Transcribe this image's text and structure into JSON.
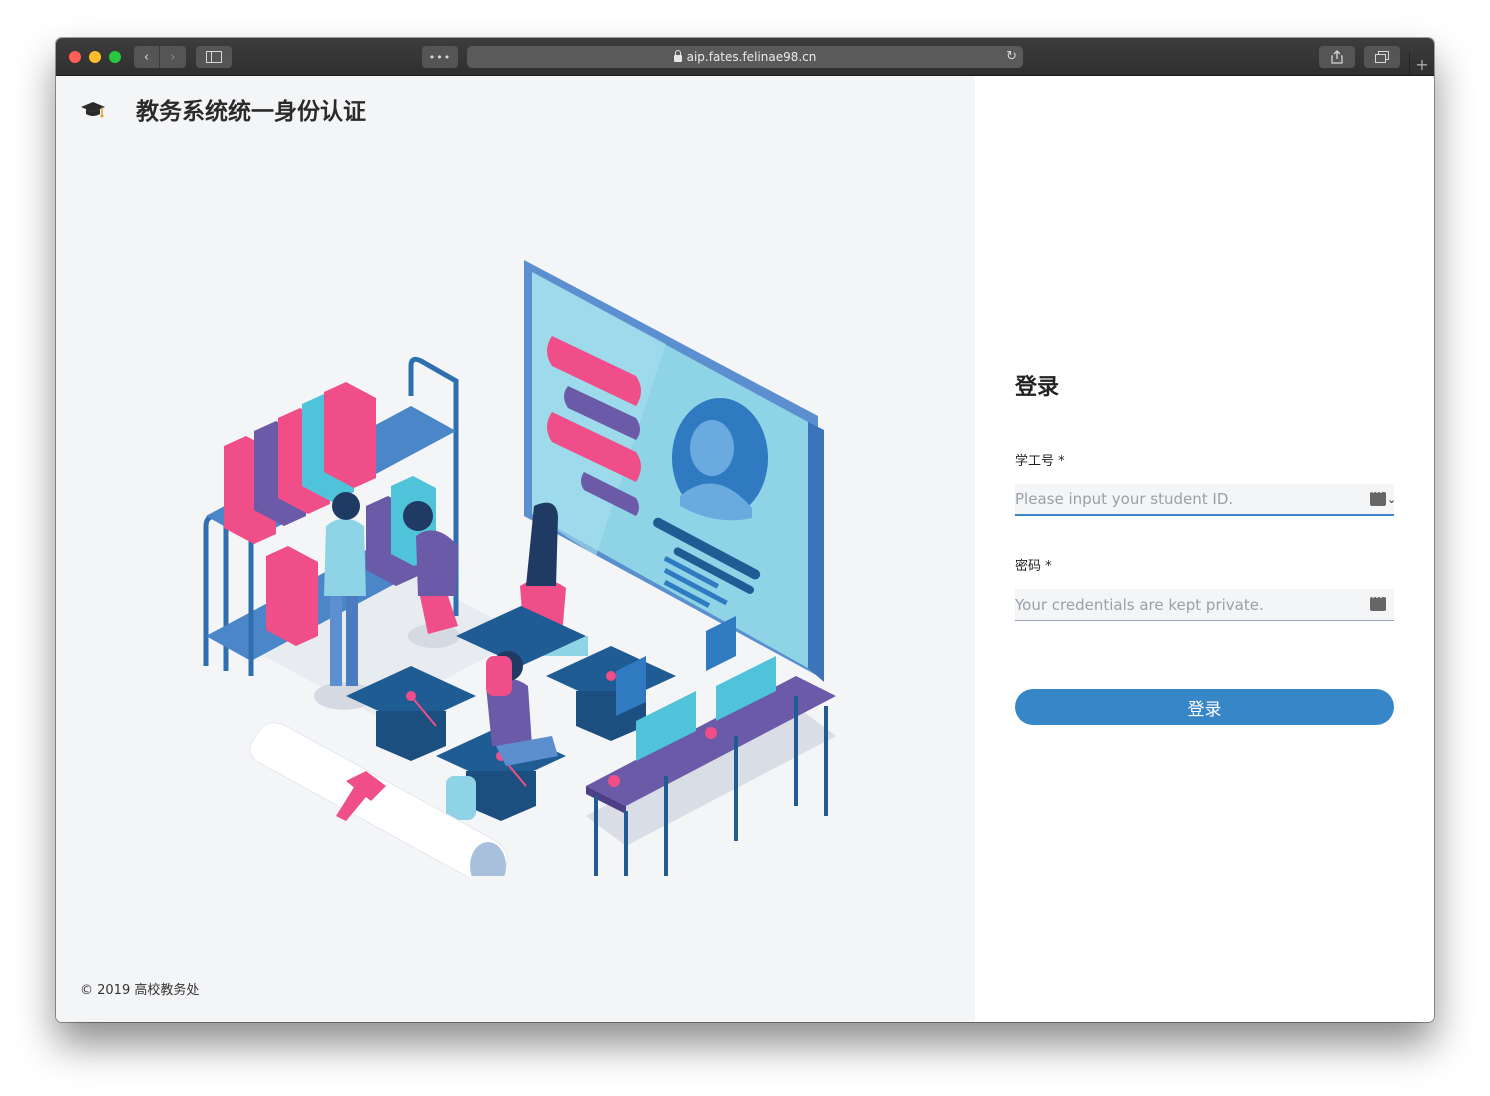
{
  "browser": {
    "url": "aip.fates.felinae98.cn",
    "dots_label": "•••",
    "back_glyph": "‹",
    "forward_glyph": "›",
    "newtab_glyph": "+"
  },
  "page": {
    "site_title": "教务系统统一身份认证",
    "footer": "© 2019 高校教务处",
    "brand_icon": "graduation-cap-icon"
  },
  "login": {
    "title": "登录",
    "student_id_label": "学工号 *",
    "student_id_placeholder": "Please input your student ID.",
    "password_label": "密码 *",
    "password_placeholder": "Your credentials are kept private.",
    "submit_label": "登录"
  },
  "colors": {
    "accent": "#3786c8",
    "left_bg": "#f4f5f7",
    "pink": "#ef4e88",
    "purple": "#6b5aa8",
    "navy": "#1f5c93",
    "cyan": "#4fc3d9"
  }
}
